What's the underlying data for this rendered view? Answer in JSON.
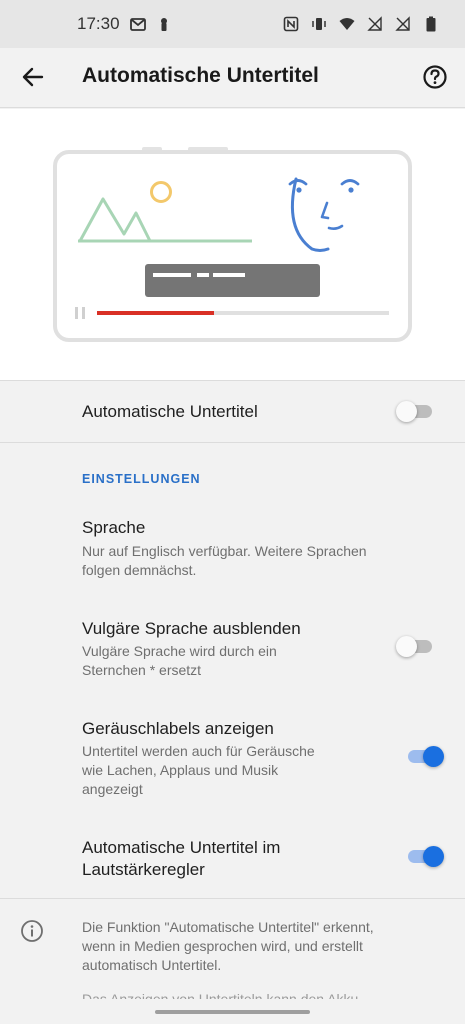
{
  "status_bar": {
    "time": "17:30"
  },
  "app_bar": {
    "title": "Automatische Untertitel"
  },
  "master_toggle": {
    "label": "Automatische Untertitel",
    "checked": false
  },
  "settings": {
    "section_header": "EINSTELLUNGEN",
    "items": [
      {
        "title": "Sprache",
        "summary_line1": "Nur auf Englisch verfügbar. Weitere Sprachen",
        "summary_line2": "folgen demnächst."
      },
      {
        "title": "Vulgäre Sprache ausblenden",
        "summary_line1": "Vulgäre Sprache wird durch ein",
        "summary_line2": "Sternchen * ersetzt",
        "checked": false
      },
      {
        "title": "Geräuschlabels anzeigen",
        "summary_line1": "Untertitel werden auch für Geräusche",
        "summary_line2": "wie Lachen, Applaus und Musik",
        "summary_line3": "angezeigt",
        "checked": true
      },
      {
        "title_line1": "Automatische Untertitel im",
        "title_line2": "Lautstärkeregler",
        "checked": true
      }
    ]
  },
  "info": {
    "line1": "Die Funktion \"Automatische Untertitel\" erkennt,",
    "line2": "wenn in Medien gesprochen wird, und erstellt",
    "line3": "automatisch Untertitel.",
    "line4": "Das Anzeigen von Untertiteln kann den Akku"
  },
  "colors": {
    "accent": "#1a6fe0",
    "section_header": "#2a70c8",
    "caption_bar": "#757575",
    "progress": "#d93025",
    "illustration_green": "#a8d5b5",
    "illustration_blue": "#4a7fd1",
    "sun": "#f3c86b"
  },
  "icons": {
    "back": "arrow-left-icon",
    "help": "help-circle-icon",
    "info": "info-circle-icon"
  },
  "video_progress": 0.4
}
